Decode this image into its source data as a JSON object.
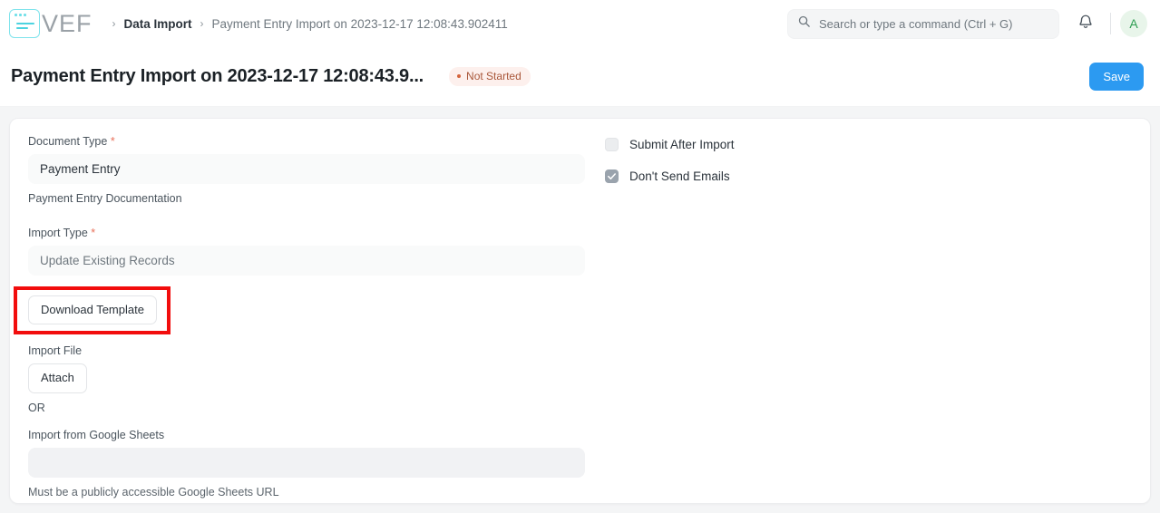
{
  "navbar": {
    "logo": {
      "icon": "app-window-logo-icon",
      "text": "VEF"
    },
    "breadcrumb": {
      "separator": "›",
      "items": [
        {
          "label": "Data Import",
          "active": true
        },
        {
          "label": "Payment Entry Import on 2023-12-17 12:08:43.902411",
          "active": false
        }
      ]
    },
    "search": {
      "icon": "search-icon",
      "placeholder": "Search or type a command (Ctrl + G)",
      "value": ""
    },
    "notifications_icon": "bell-icon",
    "avatar": {
      "initial": "A",
      "bg": "#e8f5ea",
      "fg": "#2e9e52"
    }
  },
  "page_header": {
    "title": "Payment Entry Import on 2023-12-17 12:08:43.9...",
    "status": {
      "label": "Not Started",
      "bg": "#fdf0ed",
      "fg": "#a9573a",
      "dot": "#d4643c"
    },
    "save_label": "Save",
    "save_color": "#2c9af1"
  },
  "form": {
    "document_type": {
      "label": "Document Type",
      "required_marker": "*",
      "value": "Payment Entry"
    },
    "documentation_link": "Payment Entry Documentation",
    "import_type": {
      "label": "Import Type",
      "required_marker": "*",
      "value": "Update Existing Records"
    },
    "download_template_label": "Download Template",
    "import_file": {
      "label": "Import File",
      "attach_label": "Attach"
    },
    "or_label": "OR",
    "google_sheets": {
      "label": "Import from Google Sheets",
      "value": "",
      "helper": "Must be a publicly accessible Google Sheets URL"
    },
    "options": [
      {
        "label": "Submit After Import",
        "checked": false
      },
      {
        "label": "Don't Send Emails",
        "checked": true
      }
    ]
  },
  "annotation": {
    "target": "download-template-button",
    "color": "#f20d0d"
  }
}
